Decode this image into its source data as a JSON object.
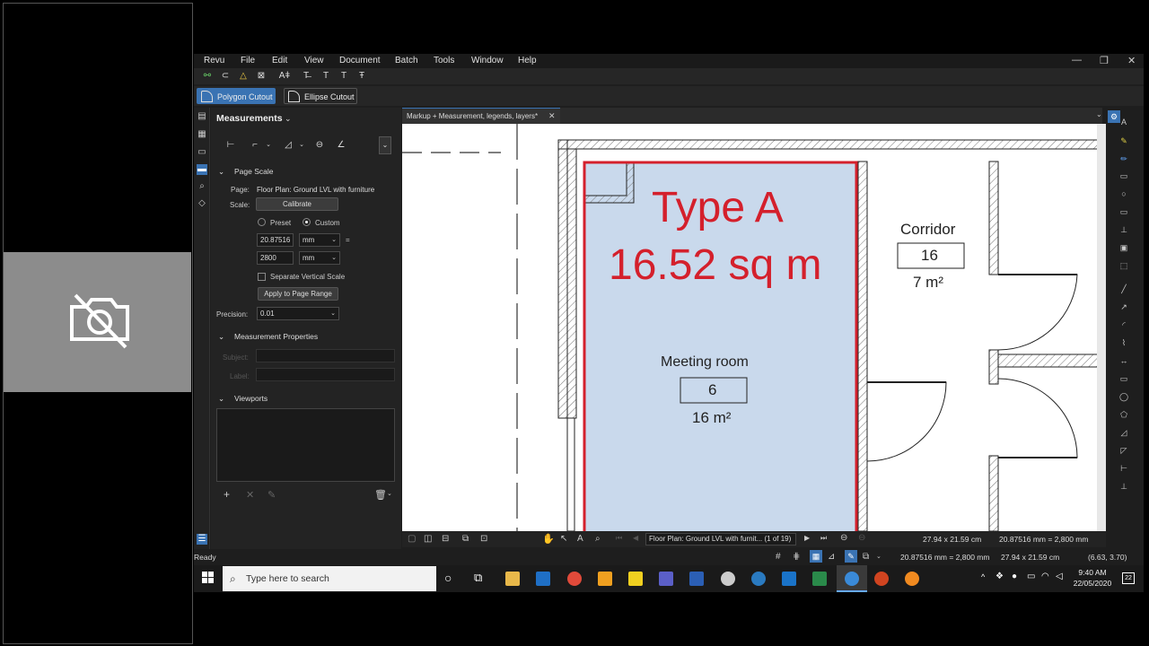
{
  "menu": [
    "Revu",
    "File",
    "Edit",
    "View",
    "Document",
    "Batch",
    "Tools",
    "Window",
    "Help"
  ],
  "window_controls": {
    "minimize": "—",
    "restore": "❐",
    "close": "✕"
  },
  "toolbar2": {
    "polygon_cutout": "Polygon Cutout",
    "ellipse_cutout": "Ellipse Cutout"
  },
  "panel": {
    "title": "Measurements",
    "page_scale_header": "Page Scale",
    "page_label": "Page:",
    "page_value": "Floor Plan: Ground LVL with furniture",
    "scale_label": "Scale:",
    "calibrate": "Calibrate",
    "preset": "Preset",
    "custom": "Custom",
    "scale_value_1": "20.87516",
    "unit_1": "mm",
    "equals": "=",
    "scale_value_2": "2800",
    "unit_2": "mm",
    "separate_vertical": "Separate Vertical Scale",
    "apply_range": "Apply to Page Range",
    "precision_label": "Precision:",
    "precision_value": "0.01",
    "measurement_props_header": "Measurement Properties",
    "subject_label": "Subject:",
    "label_label": "Label:",
    "viewports_header": "Viewports"
  },
  "document": {
    "tab_title": "Markup + Measurement, legends, layers*",
    "markup_title": "Type A",
    "markup_area": "16.52 sq m",
    "room1_name": "Meeting room",
    "room1_number": "6",
    "room1_area": "16 m²",
    "room2_name": "Corridor",
    "room2_number": "16",
    "room2_area": "7 m²"
  },
  "doc_bottom": {
    "page_nav": "Floor Plan: Ground LVL with furnit... (1 of 19)",
    "page_size": "27.94 x 21.59 cm",
    "scale": "20.87516 mm = 2,800 mm"
  },
  "status": {
    "ready": "Ready",
    "scale": "20.87516 mm = 2,800 mm",
    "page_size": "27.94 x 21.59 cm",
    "coords": "(6.63, 3.70)"
  },
  "taskbar": {
    "search_placeholder": "Type here to search",
    "time": "9:40 AM",
    "date": "22/05/2020",
    "notification_count": "22"
  },
  "colors": {
    "accent": "#3a73b3",
    "markup_red": "#d4202c",
    "room_fill": "#c9d9ec"
  }
}
